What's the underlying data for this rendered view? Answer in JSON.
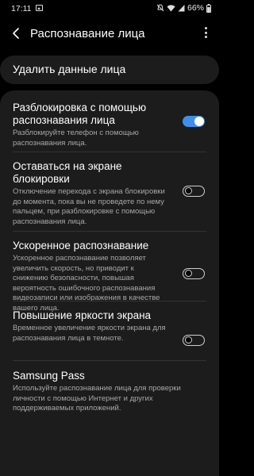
{
  "status_bar": {
    "time": "17:11",
    "battery_percent": "66%",
    "icons": [
      "gallery-icon",
      "mute-icon",
      "wifi-icon",
      "signal-icon",
      "battery-icon"
    ]
  },
  "header": {
    "title": "Распознавание лица"
  },
  "delete_card": {
    "label": "Удалить данные лица"
  },
  "settings": [
    {
      "title": "Разблокировка с помощью распознавания лица",
      "subtitle": "Разблокируйте телефон с помощью распознавания лица.",
      "toggle": true
    },
    {
      "title": "Оставаться на экране блокировки",
      "subtitle": "Отключение перехода с экрана блокировки до момента, пока вы не проведете по нему пальцем, при разблокировке с помощью распознавания лица.",
      "toggle": false
    },
    {
      "title": "Ускоренное распознавание",
      "subtitle": "Ускоренное распознавание позволяет увеличить скорость, но приводит к снижению безопасности, повышая вероятность ошибочного распознавания видеозаписи или изображения в качестве вашего лица.",
      "toggle": false
    },
    {
      "title": "Повышение яркости экрана",
      "subtitle": "Временное увеличение яркости экрана для распознавания лица в темноте.",
      "toggle": false
    },
    {
      "title": "Samsung Pass",
      "subtitle": "Используйте распознавание лица для проверки личности с помощью Интернет и других поддерживаемых приложений."
    }
  ],
  "colors": {
    "accent": "#3e8fea",
    "card": "#1c1c1c",
    "background": "#000000"
  }
}
